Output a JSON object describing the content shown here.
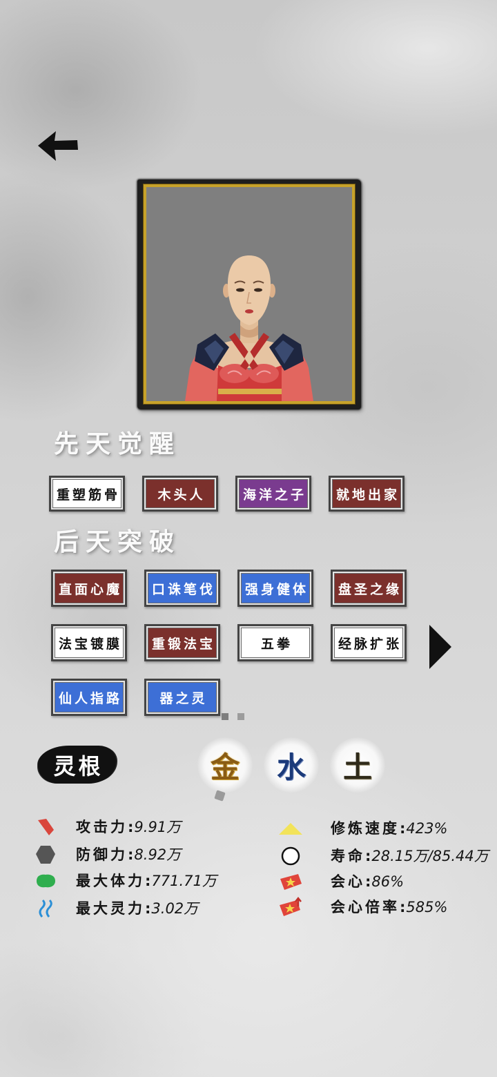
{
  "nav": {
    "back_icon": "arrow-left-icon"
  },
  "portrait": {
    "background": "#7f7f7f",
    "border_color": "#c7a22a"
  },
  "innate": {
    "title": "先天觉醒",
    "tags": [
      {
        "label": "重塑筋骨",
        "bg": "#ffffff",
        "fg": "#111111"
      },
      {
        "label": "木头人",
        "bg": "#7b302c",
        "fg": "#ffffff"
      },
      {
        "label": "海洋之子",
        "bg": "#7a3b8f",
        "fg": "#ffffff"
      },
      {
        "label": "就地出家",
        "bg": "#7b302c",
        "fg": "#ffffff"
      }
    ]
  },
  "acquired": {
    "title": "后天突破",
    "tags": [
      {
        "label": "直面心魔",
        "bg": "#7b302c",
        "fg": "#ffffff"
      },
      {
        "label": "口诛笔伐",
        "bg": "#3d6fd6",
        "fg": "#ffffff"
      },
      {
        "label": "强身健体",
        "bg": "#3d6fd6",
        "fg": "#ffffff"
      },
      {
        "label": "盘圣之缘",
        "bg": "#7b302c",
        "fg": "#ffffff"
      },
      {
        "label": "法宝镀膜",
        "bg": "#ffffff",
        "fg": "#111111"
      },
      {
        "label": "重锻法宝",
        "bg": "#7b302c",
        "fg": "#ffffff"
      },
      {
        "label": "五拳",
        "bg": "#ffffff",
        "fg": "#111111"
      },
      {
        "label": "经脉扩张",
        "bg": "#ffffff",
        "fg": "#111111"
      },
      {
        "label": "仙人指路",
        "bg": "#3d6fd6",
        "fg": "#ffffff"
      },
      {
        "label": "器之灵",
        "bg": "#3d6fd6",
        "fg": "#ffffff"
      }
    ],
    "next_icon": "triangle-right-icon",
    "pagination": {
      "page_count": 2,
      "current": 1
    }
  },
  "spirit_root": {
    "label": "灵根",
    "elements": [
      {
        "char": "金",
        "color": "#8a5c14"
      },
      {
        "char": "水",
        "color": "#1b3a7a"
      },
      {
        "char": "土",
        "color": "#2f2a1a"
      }
    ]
  },
  "stats": {
    "separator": ":",
    "left": [
      {
        "icon": "attack-icon",
        "color": "#d9463c",
        "label": "攻击力",
        "value": "9.91万"
      },
      {
        "icon": "defense-icon",
        "color": "#555555",
        "label": "防御力",
        "value": "8.92万"
      },
      {
        "icon": "health-icon",
        "color": "#2fae4e",
        "label": "最大体力",
        "value": "771.71万"
      },
      {
        "icon": "spirit-icon",
        "color": "#2b8fd6",
        "label": "最大灵力",
        "value": "3.02万"
      }
    ],
    "right": [
      {
        "icon": "cultivation-speed-icon",
        "color": "#f2e35a",
        "label": "修炼速度",
        "value": "423%"
      },
      {
        "icon": "lifespan-icon",
        "color": "#ffffff",
        "label": "寿命",
        "value": "28.15万/85.44万"
      },
      {
        "icon": "crit-icon",
        "color": "#e0443a",
        "label": "会心",
        "value": "86%"
      },
      {
        "icon": "crit-multiplier-icon",
        "color": "#e0443a",
        "label": "会心倍率",
        "value": "585%"
      }
    ]
  }
}
